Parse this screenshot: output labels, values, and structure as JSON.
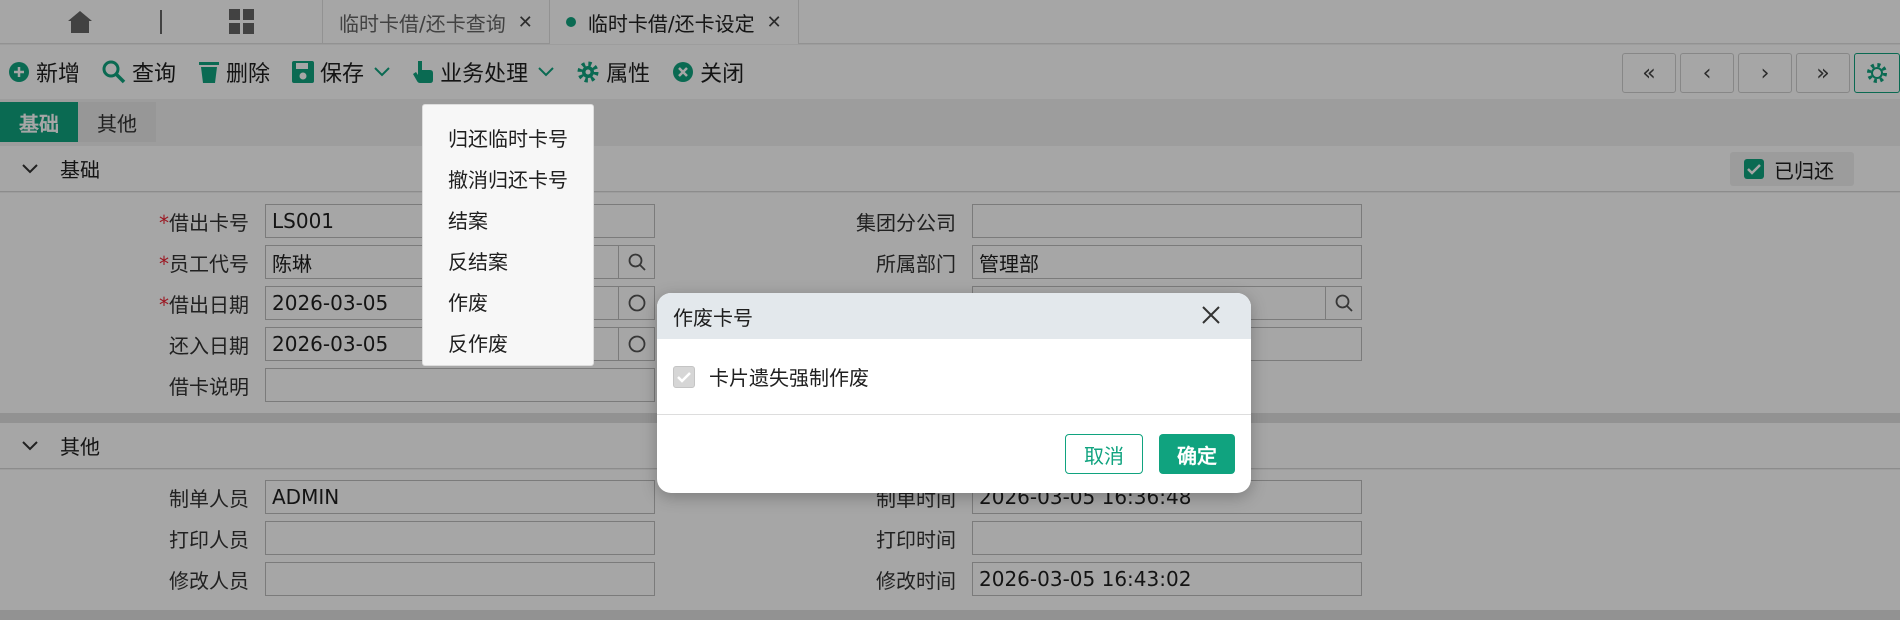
{
  "tabs": [
    {
      "label": "临时卡借/还卡查询",
      "active": false
    },
    {
      "label": "临时卡借/还卡设定",
      "active": true
    }
  ],
  "toolbar": {
    "add": "新增",
    "query": "查询",
    "delete": "删除",
    "save": "保存",
    "business": "业务处理",
    "properties": "属性",
    "close": "关闭"
  },
  "subtabs": [
    "基础",
    "其他"
  ],
  "basic": {
    "title": "基础",
    "returned_label": "已归还",
    "returned_checked": true,
    "card_no": {
      "label": "借出卡号",
      "value": "LS001"
    },
    "emp_code": {
      "label": "员工代号",
      "value": "陈琳"
    },
    "borrow_date": {
      "label": "借出日期",
      "value": "2026-03-05"
    },
    "return_date": {
      "label": "还入日期",
      "value": "2026-03-05"
    },
    "remark": {
      "label": "借卡说明",
      "value": ""
    },
    "group_company": {
      "label": "集团分公司",
      "value": ""
    },
    "department": {
      "label": "所属部门",
      "value": "管理部"
    }
  },
  "other": {
    "title": "其他",
    "creator": {
      "label": "制单人员",
      "value": "ADMIN"
    },
    "printer": {
      "label": "打印人员",
      "value": ""
    },
    "modifier": {
      "label": "修改人员",
      "value": ""
    },
    "create_time": {
      "label": "制单时间",
      "value": "2026-03-05 16:36:48"
    },
    "print_time": {
      "label": "打印时间",
      "value": ""
    },
    "modify_time": {
      "label": "修改时间",
      "value": "2026-03-05 16:43:02"
    }
  },
  "dropdown": [
    "归还临时卡号",
    "撤消归还卡号",
    "结案",
    "反结案",
    "作废",
    "反作废"
  ],
  "modal": {
    "title": "作废卡号",
    "checkbox_label": "卡片遗失强制作废",
    "checkbox_checked": true,
    "cancel": "取消",
    "ok": "确定"
  },
  "colors": {
    "accent": "#10a37f",
    "required": "#e23333"
  }
}
